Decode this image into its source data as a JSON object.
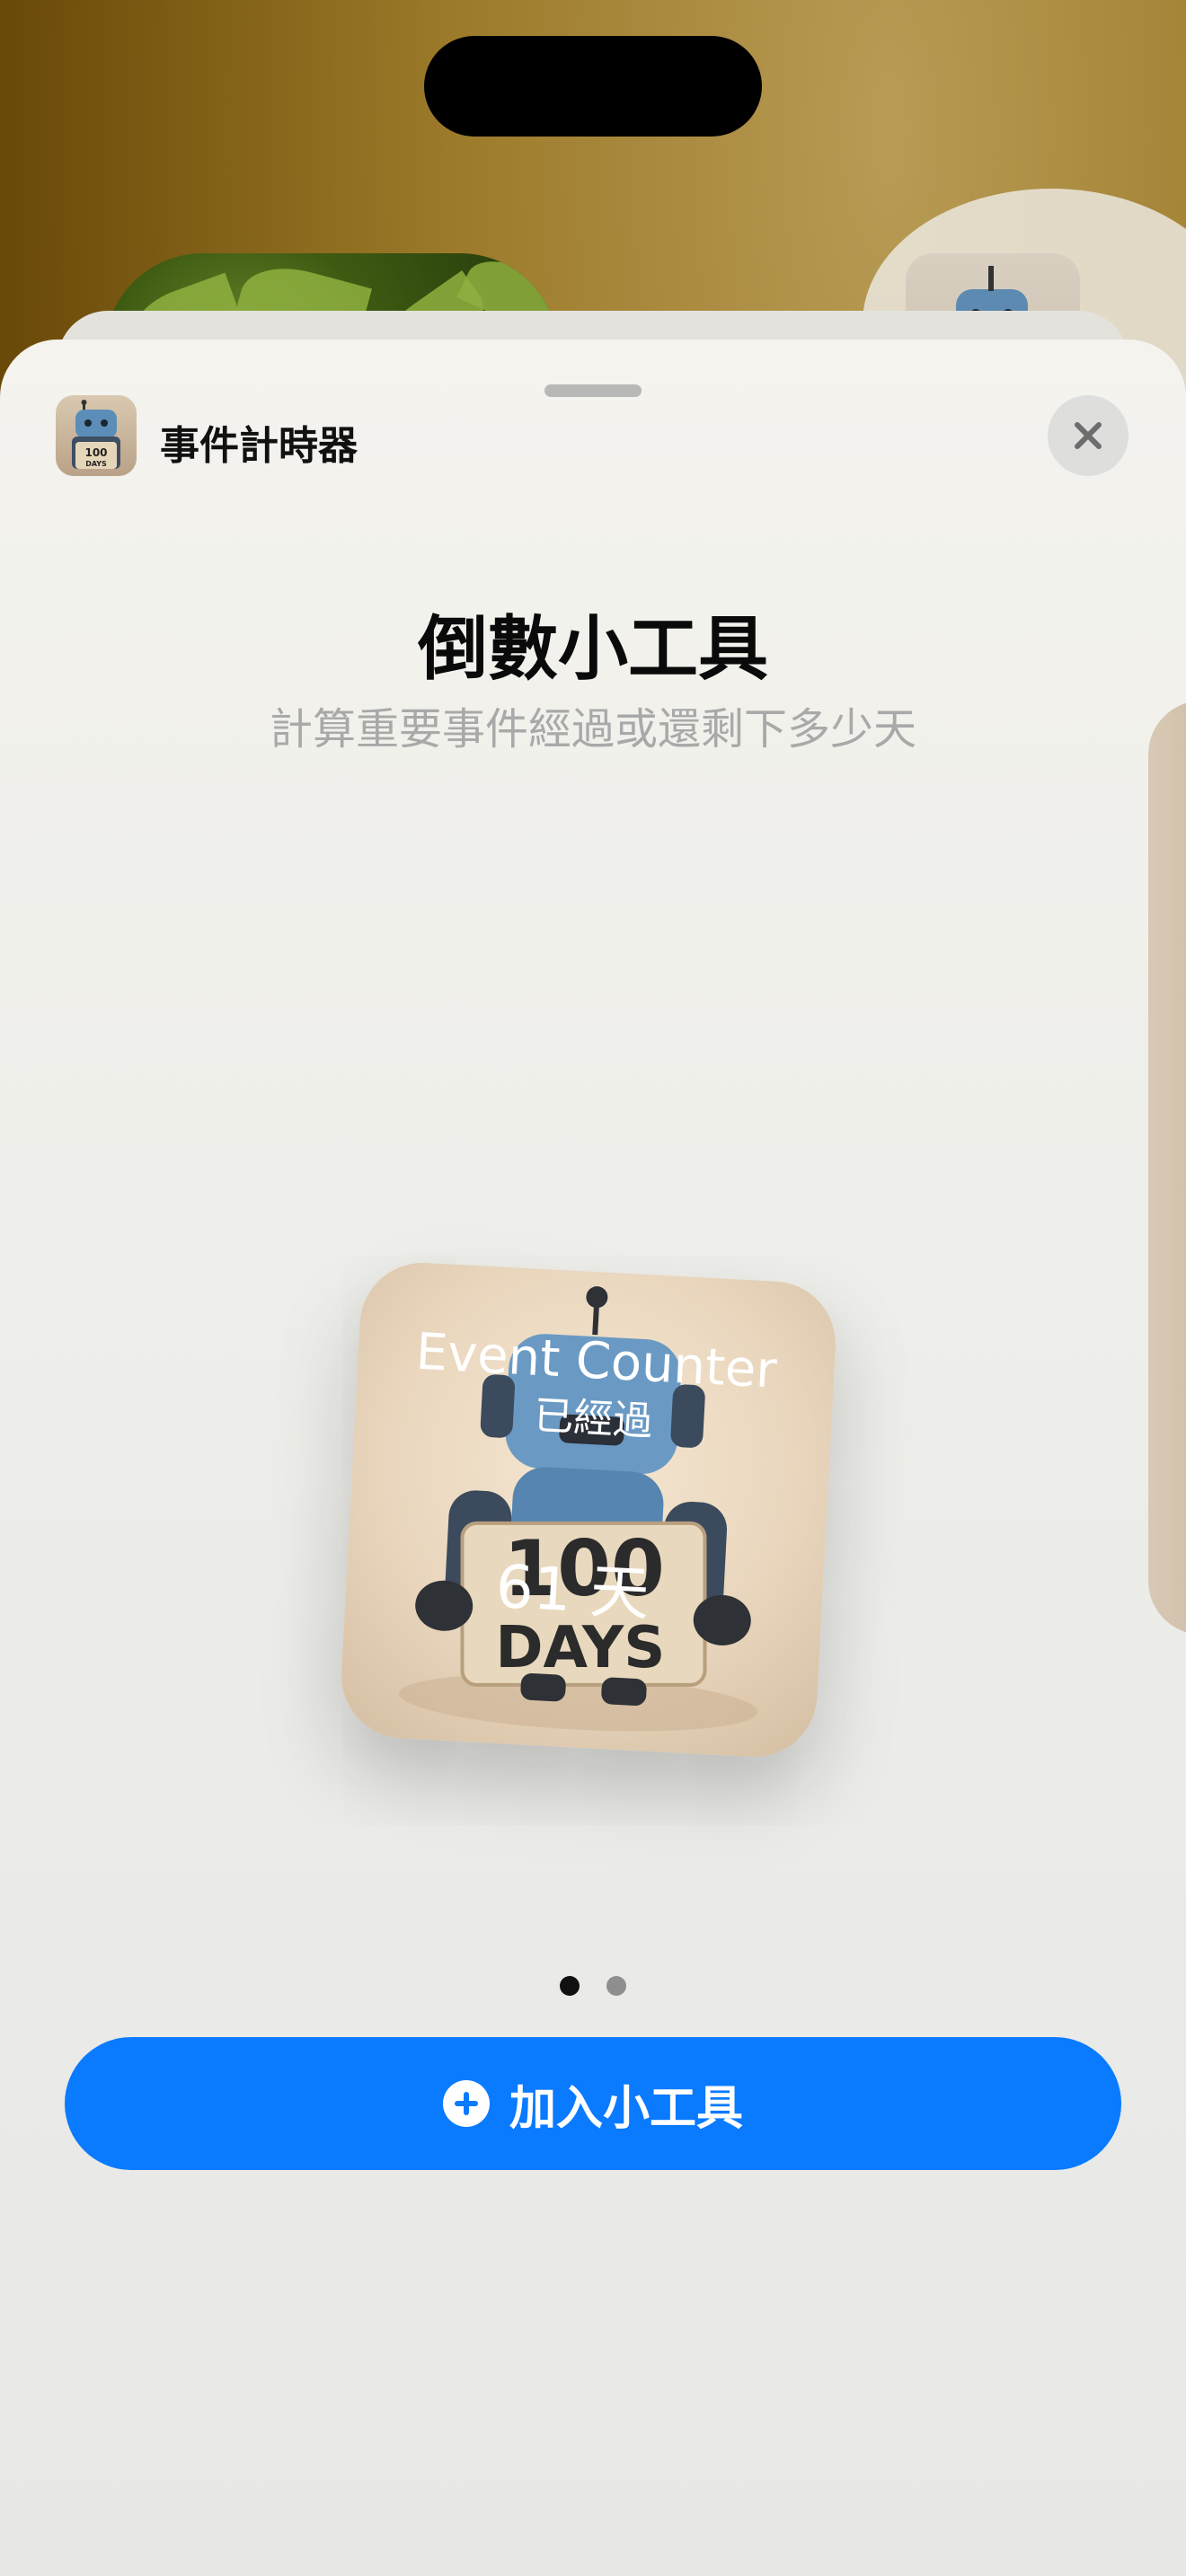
{
  "app": {
    "name": "事件計時器",
    "icon": "robot-100-days-icon",
    "icon_text": [
      "100",
      "DAYS"
    ]
  },
  "header": {
    "close_icon": "close-icon"
  },
  "sheet": {
    "title": "倒數小工具",
    "subtitle": "計算重要事件經過或還剩下多少天"
  },
  "widget": {
    "title": "Event Counter",
    "status": "已經過",
    "count": "61 天",
    "sign_text": [
      "100",
      "DAYS"
    ]
  },
  "pager": {
    "total": 2,
    "active": 1
  },
  "add_button": {
    "label": "加入小工具",
    "icon": "plus-circle-icon"
  },
  "colors": {
    "accent": "#0a7aff",
    "sheet_bg": "#eeeeea",
    "dot_active": "#111111",
    "dot_inactive": "#8e8e8e"
  }
}
